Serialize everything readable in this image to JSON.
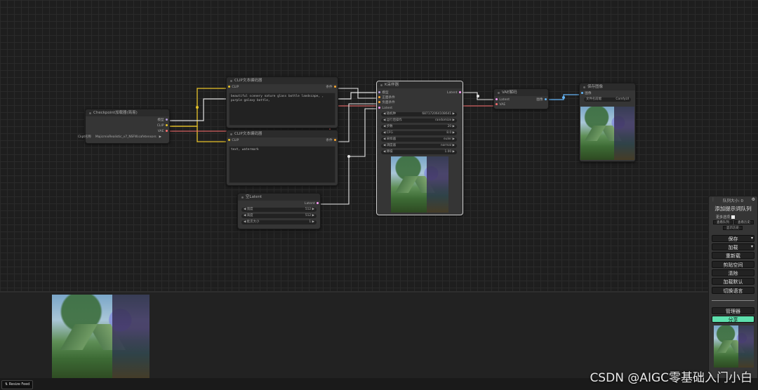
{
  "nodes": {
    "checkpoint": {
      "title": "Checkpoint加载器(简易)",
      "outputs": [
        "模型",
        "CLIP",
        "VAE"
      ],
      "ckpt_label": "Ckpt名称",
      "ckpt_value": "MajicmixRealistic_v7_NSFW.safetensors"
    },
    "clip_pos": {
      "title": "CLIP文本编码器",
      "input": "CLIP",
      "output": "条件",
      "text": "beautiful scenery nature glass bottle landscape, , purple galaxy bottle,"
    },
    "clip_neg": {
      "title": "CLIP文本编码器",
      "input": "CLIP",
      "output": "条件",
      "text": "text, watermark"
    },
    "ksampler": {
      "title": "K采样器",
      "inputs": [
        "模型",
        "正面条件",
        "负面条件",
        "Latent"
      ],
      "output": "Latent",
      "widgets": [
        {
          "label": "随机种",
          "value": "687172064108641"
        },
        {
          "label": "运行后操作",
          "value": "randomize"
        },
        {
          "label": "步数",
          "value": "20"
        },
        {
          "label": "CFG",
          "value": "8.0"
        },
        {
          "label": "采样器",
          "value": "euler"
        },
        {
          "label": "调度器",
          "value": "normal"
        },
        {
          "label": "降噪",
          "value": "1.00"
        }
      ]
    },
    "empty_latent": {
      "title": "空Latent",
      "output": "Latent",
      "widgets": [
        {
          "label": "宽度",
          "value": "512"
        },
        {
          "label": "高度",
          "value": "512"
        },
        {
          "label": "批次大小",
          "value": "1"
        }
      ]
    },
    "vae_decode": {
      "title": "VAE解码",
      "inputs": [
        "Latent",
        "VAE"
      ],
      "output": "图像"
    },
    "save_image": {
      "title": "保存图像",
      "input": "图像",
      "prefix_label": "文件名前缀",
      "prefix_value": "ComfyUI"
    }
  },
  "menu": {
    "queue_size": "队列大小: 0",
    "queue_prompt": "添加提示词队列",
    "extra_options": "更多选项",
    "view_queue": "查看队列",
    "view_history": "查看历史",
    "view_history2": "显示历史",
    "save": "保存",
    "load": "加载",
    "refresh": "重新载",
    "clipspace": "剪贴空间",
    "clear": "清除",
    "load_default": "加载默认",
    "switch_lang": "切换语言",
    "manager": "管理器",
    "share": "分享"
  },
  "status": {
    "resize_feed": "Resize Feed"
  },
  "watermark": "CSDN @AIGC零基础入门小白",
  "colors": {
    "clip_wire": "#e6c229",
    "model_wire": "#e0e0e0",
    "vae_wire": "#ff6e6e",
    "latent_wire": "#ff9cf9",
    "cond_wire": "#ffa931",
    "image_wire": "#64b5f6",
    "share_button": "#5ee0ad"
  }
}
